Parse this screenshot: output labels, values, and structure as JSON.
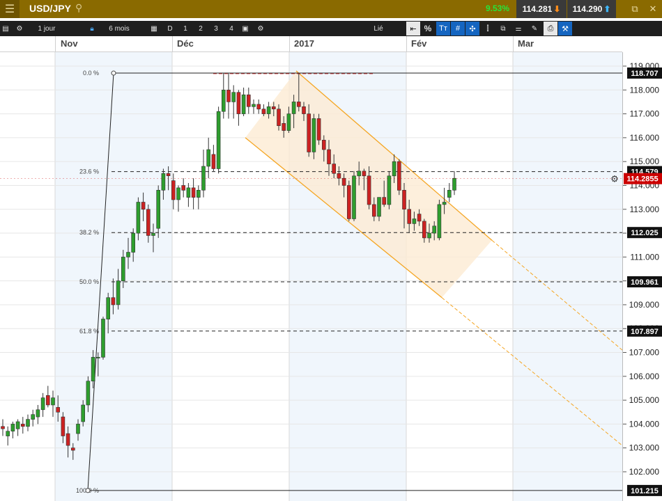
{
  "header": {
    "menu_icon": "hamburger-menu-icon",
    "symbol": "USD/JPY",
    "change": "9.53%",
    "bid": "114.281",
    "ask": "114.290",
    "colors": {
      "bar": "#8a6a00",
      "up": "#27e53a",
      "down_arrow": "#ff8c1a",
      "up_arrow": "#3fb8ff"
    }
  },
  "toolbar": {
    "interval": "1 jour",
    "range": "6 mois",
    "d_label": "D",
    "num1": "1",
    "num2": "2",
    "num3": "3",
    "num4": "4",
    "linked": "Lié",
    "pct": "%"
  },
  "chart_data": {
    "type": "candlestick",
    "symbol": "USD/JPY",
    "x_tick_labels": [
      "Nov",
      "Déc",
      "2017",
      "Fév",
      "Mar"
    ],
    "y_ticks": [
      102,
      103,
      104,
      105,
      106,
      107,
      108,
      109,
      110,
      111,
      112,
      113,
      114,
      115,
      116,
      117,
      118,
      119
    ],
    "y_tick_labels": [
      "102.000",
      "103.000",
      "104.000",
      "105.000",
      "106.000",
      "107.000",
      "108.000",
      "109.000",
      "110.000",
      "111.000",
      "112.000",
      "113.000",
      "114.000",
      "115.000",
      "116.000",
      "117.000",
      "118.000",
      "119.000"
    ],
    "ylim": [
      101.0,
      119.4
    ],
    "current_price": "114.2855",
    "candles": [
      {
        "o": 103.9,
        "h": 104.2,
        "l": 103.5,
        "c": 103.8
      },
      {
        "o": 103.5,
        "h": 103.9,
        "l": 103.1,
        "c": 103.7
      },
      {
        "o": 103.7,
        "h": 104.1,
        "l": 103.4,
        "c": 104.0
      },
      {
        "o": 103.8,
        "h": 104.2,
        "l": 103.5,
        "c": 104.1
      },
      {
        "o": 104.0,
        "h": 104.3,
        "l": 103.6,
        "c": 103.9
      },
      {
        "o": 103.9,
        "h": 104.4,
        "l": 103.7,
        "c": 104.2
      },
      {
        "o": 104.2,
        "h": 104.6,
        "l": 103.9,
        "c": 104.4
      },
      {
        "o": 104.3,
        "h": 104.8,
        "l": 104.0,
        "c": 104.6
      },
      {
        "o": 104.6,
        "h": 105.3,
        "l": 104.3,
        "c": 105.1
      },
      {
        "o": 105.2,
        "h": 105.6,
        "l": 104.7,
        "c": 104.8
      },
      {
        "o": 104.8,
        "h": 105.4,
        "l": 104.3,
        "c": 105.1
      },
      {
        "o": 104.7,
        "h": 105.2,
        "l": 104.1,
        "c": 104.5
      },
      {
        "o": 104.3,
        "h": 104.5,
        "l": 103.2,
        "c": 103.5
      },
      {
        "o": 103.6,
        "h": 103.9,
        "l": 102.6,
        "c": 103.1
      },
      {
        "o": 103.0,
        "h": 103.2,
        "l": 102.5,
        "c": 102.9
      },
      {
        "o": 103.6,
        "h": 104.2,
        "l": 103.3,
        "c": 104.0
      },
      {
        "o": 104.1,
        "h": 105.0,
        "l": 103.9,
        "c": 104.8
      },
      {
        "o": 104.8,
        "h": 106.0,
        "l": 104.5,
        "c": 105.8
      },
      {
        "o": 105.8,
        "h": 107.1,
        "l": 105.5,
        "c": 106.8
      },
      {
        "o": 106.8,
        "h": 107.0,
        "l": 106.0,
        "c": 106.8
      },
      {
        "o": 106.8,
        "h": 108.5,
        "l": 106.7,
        "c": 108.4
      },
      {
        "o": 108.4,
        "h": 109.5,
        "l": 107.8,
        "c": 109.3
      },
      {
        "o": 109.3,
        "h": 110.1,
        "l": 108.6,
        "c": 109.0
      },
      {
        "o": 109.0,
        "h": 110.5,
        "l": 108.8,
        "c": 110.0
      },
      {
        "o": 110.0,
        "h": 111.3,
        "l": 109.7,
        "c": 111.0
      },
      {
        "o": 111.0,
        "h": 111.8,
        "l": 110.5,
        "c": 111.2
      },
      {
        "o": 111.2,
        "h": 112.2,
        "l": 110.8,
        "c": 112.0
      },
      {
        "o": 112.0,
        "h": 113.5,
        "l": 111.7,
        "c": 113.3
      },
      {
        "o": 113.3,
        "h": 113.7,
        "l": 112.5,
        "c": 113.0
      },
      {
        "o": 113.0,
        "h": 113.2,
        "l": 111.6,
        "c": 111.9
      },
      {
        "o": 111.9,
        "h": 112.4,
        "l": 111.2,
        "c": 112.0
      },
      {
        "o": 112.2,
        "h": 114.0,
        "l": 111.8,
        "c": 113.8
      },
      {
        "o": 113.8,
        "h": 114.7,
        "l": 113.4,
        "c": 114.5
      },
      {
        "o": 114.5,
        "h": 114.8,
        "l": 113.8,
        "c": 114.4
      },
      {
        "o": 114.2,
        "h": 114.5,
        "l": 113.0,
        "c": 113.4
      },
      {
        "o": 113.4,
        "h": 114.0,
        "l": 112.9,
        "c": 113.9
      },
      {
        "o": 114.0,
        "h": 114.3,
        "l": 113.5,
        "c": 113.8
      },
      {
        "o": 113.5,
        "h": 114.1,
        "l": 113.1,
        "c": 113.9
      },
      {
        "o": 113.9,
        "h": 114.3,
        "l": 113.0,
        "c": 113.5
      },
      {
        "o": 113.5,
        "h": 114.0,
        "l": 113.0,
        "c": 113.8
      },
      {
        "o": 113.8,
        "h": 115.5,
        "l": 113.5,
        "c": 114.8
      },
      {
        "o": 114.8,
        "h": 116.0,
        "l": 114.3,
        "c": 115.5
      },
      {
        "o": 115.3,
        "h": 115.7,
        "l": 114.6,
        "c": 114.7
      },
      {
        "o": 114.7,
        "h": 117.3,
        "l": 114.5,
        "c": 117.1
      },
      {
        "o": 117.1,
        "h": 118.7,
        "l": 116.8,
        "c": 118.0
      },
      {
        "o": 118.0,
        "h": 118.7,
        "l": 116.8,
        "c": 117.5
      },
      {
        "o": 117.5,
        "h": 118.2,
        "l": 116.8,
        "c": 117.9
      },
      {
        "o": 117.9,
        "h": 118.0,
        "l": 116.5,
        "c": 117.0
      },
      {
        "o": 117.0,
        "h": 118.1,
        "l": 116.9,
        "c": 117.8
      },
      {
        "o": 117.8,
        "h": 118.1,
        "l": 117.0,
        "c": 117.3
      },
      {
        "o": 117.3,
        "h": 117.6,
        "l": 117.0,
        "c": 117.4
      },
      {
        "o": 117.4,
        "h": 117.6,
        "l": 117.0,
        "c": 117.2
      },
      {
        "o": 117.2,
        "h": 117.4,
        "l": 116.9,
        "c": 117.0
      },
      {
        "o": 117.0,
        "h": 117.5,
        "l": 116.8,
        "c": 117.3
      },
      {
        "o": 117.3,
        "h": 117.5,
        "l": 116.9,
        "c": 117.2
      },
      {
        "o": 117.2,
        "h": 117.4,
        "l": 116.3,
        "c": 116.5
      },
      {
        "o": 116.6,
        "h": 116.9,
        "l": 116.0,
        "c": 116.3
      },
      {
        "o": 116.3,
        "h": 117.3,
        "l": 116.2,
        "c": 117.0
      },
      {
        "o": 117.0,
        "h": 117.8,
        "l": 116.4,
        "c": 117.5
      },
      {
        "o": 117.5,
        "h": 118.7,
        "l": 117.1,
        "c": 117.3
      },
      {
        "o": 117.3,
        "h": 117.5,
        "l": 116.7,
        "c": 117.0
      },
      {
        "o": 117.0,
        "h": 117.4,
        "l": 115.2,
        "c": 115.4
      },
      {
        "o": 115.4,
        "h": 117.0,
        "l": 115.1,
        "c": 116.8
      },
      {
        "o": 116.8,
        "h": 117.0,
        "l": 115.7,
        "c": 115.9
      },
      {
        "o": 115.9,
        "h": 116.1,
        "l": 115.0,
        "c": 115.5
      },
      {
        "o": 115.5,
        "h": 115.9,
        "l": 114.4,
        "c": 114.9
      },
      {
        "o": 114.9,
        "h": 115.3,
        "l": 114.3,
        "c": 114.5
      },
      {
        "o": 114.5,
        "h": 114.8,
        "l": 114.0,
        "c": 114.3
      },
      {
        "o": 114.3,
        "h": 114.5,
        "l": 113.5,
        "c": 114.0
      },
      {
        "o": 114.0,
        "h": 114.2,
        "l": 112.5,
        "c": 112.6
      },
      {
        "o": 112.6,
        "h": 114.6,
        "l": 112.5,
        "c": 114.4
      },
      {
        "o": 114.4,
        "h": 115.0,
        "l": 114.0,
        "c": 114.6
      },
      {
        "o": 114.6,
        "h": 114.7,
        "l": 113.8,
        "c": 114.4
      },
      {
        "o": 114.4,
        "h": 114.8,
        "l": 113.0,
        "c": 113.2
      },
      {
        "o": 113.2,
        "h": 113.5,
        "l": 112.5,
        "c": 112.7
      },
      {
        "o": 112.7,
        "h": 113.5,
        "l": 112.5,
        "c": 113.5
      },
      {
        "o": 113.5,
        "h": 114.2,
        "l": 113.1,
        "c": 113.2
      },
      {
        "o": 113.2,
        "h": 114.6,
        "l": 113.0,
        "c": 114.4
      },
      {
        "o": 114.4,
        "h": 115.3,
        "l": 114.1,
        "c": 115.0
      },
      {
        "o": 115.0,
        "h": 115.1,
        "l": 113.6,
        "c": 113.8
      },
      {
        "o": 113.8,
        "h": 114.1,
        "l": 112.2,
        "c": 113.0
      },
      {
        "o": 113.0,
        "h": 113.4,
        "l": 112.0,
        "c": 112.4
      },
      {
        "o": 112.4,
        "h": 112.9,
        "l": 112.1,
        "c": 112.6
      },
      {
        "o": 112.8,
        "h": 113.0,
        "l": 112.3,
        "c": 112.5
      },
      {
        "o": 112.5,
        "h": 112.6,
        "l": 111.6,
        "c": 111.8
      },
      {
        "o": 111.8,
        "h": 112.4,
        "l": 111.6,
        "c": 112.0
      },
      {
        "o": 112.0,
        "h": 112.5,
        "l": 111.7,
        "c": 112.3
      },
      {
        "o": 111.8,
        "h": 113.4,
        "l": 111.7,
        "c": 113.2
      },
      {
        "o": 113.2,
        "h": 113.9,
        "l": 112.8,
        "c": 113.3
      },
      {
        "o": 113.5,
        "h": 114.1,
        "l": 113.3,
        "c": 113.8
      },
      {
        "o": 113.8,
        "h": 114.6,
        "l": 113.6,
        "c": 114.3
      }
    ],
    "fibonacci": [
      {
        "label": "0.0 %",
        "value": 118.707
      },
      {
        "label": "23.6 %",
        "value": 114.579
      },
      {
        "label": "38.2 %",
        "value": 112.025
      },
      {
        "label": "50.0 %",
        "value": 109.961
      },
      {
        "label": "61.8 %",
        "value": 107.897
      },
      {
        "label": "100.0 %",
        "value": 101.215
      }
    ],
    "level_tags": [
      "118.707",
      "114.579",
      "112.025",
      "109.961",
      "107.897",
      "101.215"
    ],
    "colors": {
      "up": "#2e9e2e",
      "down": "#cc2222",
      "channel": "#f5a623",
      "channel_fill": "#fdebd3",
      "current_tag": "#cc0000",
      "fib_line": "#222222",
      "shade": "#f0f6fc"
    }
  }
}
